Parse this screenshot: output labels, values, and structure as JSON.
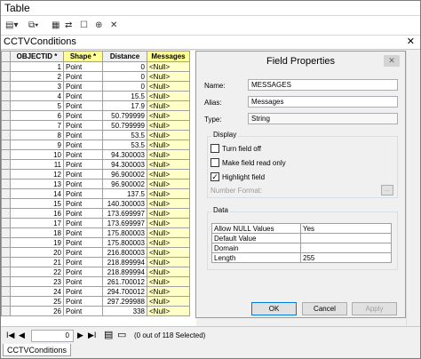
{
  "window": {
    "title": "Table"
  },
  "toolbar": {
    "icons": [
      "table-options-icon",
      "related-tables-icon",
      "select-by-attributes-icon",
      "switch-selection-icon",
      "clear-selection-icon",
      "zoom-to-selected-icon",
      "delete-selected-icon"
    ]
  },
  "tab": {
    "title": "CCTVConditions",
    "close": "✕"
  },
  "grid": {
    "headers": [
      "OBJECTID *",
      "Shape *",
      "Distance",
      "Messages"
    ],
    "rows": [
      {
        "id": "1",
        "shape": "Point",
        "distance": "0",
        "msg": "<Null>"
      },
      {
        "id": "2",
        "shape": "Point",
        "distance": "0",
        "msg": "<Null>"
      },
      {
        "id": "3",
        "shape": "Point",
        "distance": "0",
        "msg": "<Null>"
      },
      {
        "id": "4",
        "shape": "Point",
        "distance": "15.5",
        "msg": "<Null>"
      },
      {
        "id": "5",
        "shape": "Point",
        "distance": "17.9",
        "msg": "<Null>"
      },
      {
        "id": "6",
        "shape": "Point",
        "distance": "50.799999",
        "msg": "<Null>"
      },
      {
        "id": "7",
        "shape": "Point",
        "distance": "50.799999",
        "msg": "<Null>"
      },
      {
        "id": "8",
        "shape": "Point",
        "distance": "53.5",
        "msg": "<Null>"
      },
      {
        "id": "9",
        "shape": "Point",
        "distance": "53.5",
        "msg": "<Null>"
      },
      {
        "id": "10",
        "shape": "Point",
        "distance": "94.300003",
        "msg": "<Null>"
      },
      {
        "id": "11",
        "shape": "Point",
        "distance": "94.300003",
        "msg": "<Null>"
      },
      {
        "id": "12",
        "shape": "Point",
        "distance": "96.900002",
        "msg": "<Null>"
      },
      {
        "id": "13",
        "shape": "Point",
        "distance": "96.900002",
        "msg": "<Null>"
      },
      {
        "id": "14",
        "shape": "Point",
        "distance": "137.5",
        "msg": "<Null>"
      },
      {
        "id": "15",
        "shape": "Point",
        "distance": "140.300003",
        "msg": "<Null>"
      },
      {
        "id": "16",
        "shape": "Point",
        "distance": "173.699997",
        "msg": "<Null>"
      },
      {
        "id": "17",
        "shape": "Point",
        "distance": "173.699997",
        "msg": "<Null>"
      },
      {
        "id": "18",
        "shape": "Point",
        "distance": "175.800003",
        "msg": "<Null>"
      },
      {
        "id": "19",
        "shape": "Point",
        "distance": "175.800003",
        "msg": "<Null>"
      },
      {
        "id": "20",
        "shape": "Point",
        "distance": "216.800003",
        "msg": "<Null>"
      },
      {
        "id": "21",
        "shape": "Point",
        "distance": "218.899994",
        "msg": "<Null>"
      },
      {
        "id": "22",
        "shape": "Point",
        "distance": "218.899994",
        "msg": "<Null>"
      },
      {
        "id": "23",
        "shape": "Point",
        "distance": "261.700012",
        "msg": "<Null>"
      },
      {
        "id": "24",
        "shape": "Point",
        "distance": "294.700012",
        "msg": "<Null>"
      },
      {
        "id": "25",
        "shape": "Point",
        "distance": "297.299988",
        "msg": "<Null>"
      },
      {
        "id": "26",
        "shape": "Point",
        "distance": "338",
        "msg": "<Null>"
      }
    ]
  },
  "dialog": {
    "title": "Field Properties",
    "close": "✕",
    "name_label": "Name:",
    "name_value": "MESSAGES",
    "alias_label": "Alias:",
    "alias_value": "Messages",
    "type_label": "Type:",
    "type_value": "String",
    "display_label": "Display",
    "turn_off": "Turn field off",
    "read_only": "Make field read only",
    "highlight": "Highlight field",
    "number_format": "Number Format:",
    "ellipsis": "...",
    "data_label": "Data",
    "props": [
      {
        "key": "Allow NULL Values",
        "value": "Yes"
      },
      {
        "key": "Default Value",
        "value": ""
      },
      {
        "key": "Domain",
        "value": ""
      },
      {
        "key": "Length",
        "value": "255"
      }
    ],
    "ok": "OK",
    "cancel": "Cancel",
    "apply": "Apply"
  },
  "status": {
    "record": "0",
    "nav_first": "I◀",
    "nav_prev": "◀",
    "nav_next": "▶",
    "nav_last": "▶I",
    "selected": "(0 out of 118 Selected)"
  },
  "bottom_tab": "CCTVConditions"
}
